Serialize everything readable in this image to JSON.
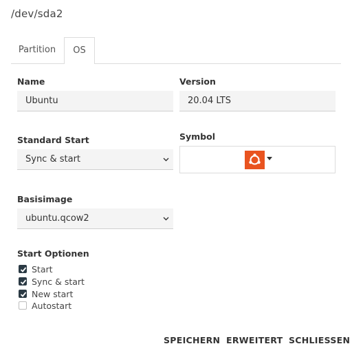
{
  "dialog": {
    "title": "/dev/sda2"
  },
  "tabs": [
    {
      "label": "Partition",
      "active": false
    },
    {
      "label": "OS",
      "active": true
    }
  ],
  "form": {
    "name": {
      "label": "Name",
      "value": "Ubuntu"
    },
    "version": {
      "label": "Version",
      "value": "20.04 LTS"
    },
    "standard_start": {
      "label": "Standard Start",
      "selected": "Sync & start"
    },
    "symbol": {
      "label": "Symbol",
      "icon": "ubuntu-logo-icon",
      "color": "#e95420"
    },
    "basisimage": {
      "label": "Basisimage",
      "selected": "ubuntu.qcow2"
    },
    "start_options": {
      "label": "Start Optionen",
      "items": [
        {
          "label": "Start",
          "checked": true
        },
        {
          "label": "Sync & start",
          "checked": true
        },
        {
          "label": "New start",
          "checked": true
        },
        {
          "label": "Autostart",
          "checked": false
        }
      ]
    }
  },
  "actions": {
    "save_label": "SPEICHERN",
    "advanced_label": "ERWEITERT",
    "close_label": "SCHLIESSEN"
  }
}
